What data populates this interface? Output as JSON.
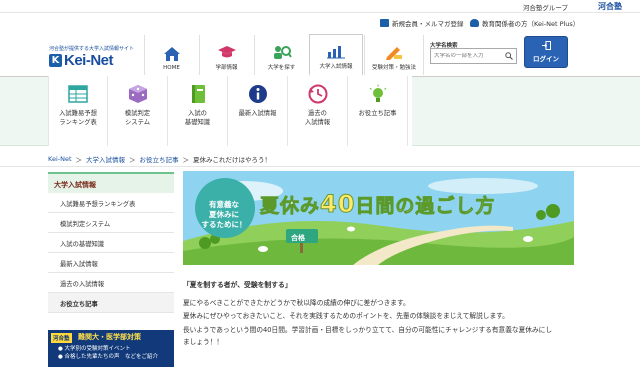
{
  "top": {
    "group_text": "河合塾グループ",
    "group_logo": "河合塾",
    "link_register": "新規会員・メルマガ登録",
    "link_teacher": "教育関係者の方（Kei-Net Plus）"
  },
  "logo": {
    "subtitle": "河合塾が提供する大学入試情報サイト",
    "mark": "K",
    "name": "Kei-Net"
  },
  "nav": {
    "tabs": [
      {
        "label": "HOME",
        "icon": "home-icon"
      },
      {
        "label": "学部情報",
        "icon": "graduation-cap-icon"
      },
      {
        "label": "大学を探す",
        "icon": "people-search-icon"
      },
      {
        "label": "大学入試情報",
        "icon": "bar-chart-icon"
      },
      {
        "label": "受験対策・勉強法",
        "icon": "pencil-icon"
      }
    ],
    "active_tab": "大学入試情報"
  },
  "search": {
    "label": "大学名検索",
    "placeholder": "大学名の一部を入力"
  },
  "login": {
    "label": "ログイン"
  },
  "subnav": {
    "items": [
      {
        "label": "入試難易予想\nランキング表",
        "icon": "table-icon"
      },
      {
        "label": "模試判定\nシステム",
        "icon": "dice-icon"
      },
      {
        "label": "入試の\n基礎知識",
        "icon": "book-icon"
      },
      {
        "label": "最新入試情報",
        "icon": "info-icon"
      },
      {
        "label": "過去の\n入試情報",
        "icon": "calendar-icon"
      },
      {
        "label": "お役立ち記事",
        "icon": "lightbulb-icon"
      }
    ]
  },
  "breadcrumb": {
    "items": [
      "Kei-Net",
      "大学入試情報",
      "お役立ち記事",
      "夏休みこれだけはやろう！"
    ],
    "separator": "＞"
  },
  "sidebar": {
    "title": "大学入試情報",
    "items": [
      "入試難易予想ランキング表",
      "模試判定システム",
      "入試の基礎知識",
      "最新入試情報",
      "過去の入試情報",
      "お役立ち記事"
    ],
    "active": "お役立ち記事"
  },
  "banner": {
    "label": "河合塾",
    "title": "難関大・医学部対策",
    "line1": "● 大学別の受験対策イベント",
    "line2": "● 合格した先輩たちの声　などをご紹介"
  },
  "hero": {
    "badge": "有意義な\n夏休みに\nするために！",
    "title_pre": "夏休み",
    "title_num": "40",
    "title_post": "日間の過ごし方",
    "sign": "合格"
  },
  "article": {
    "quote": "「夏を制する者が、受験を制する」",
    "paragraphs": [
      "夏にやるべきことができたかどうかで秋以降の成績の伸びに差がつきます。",
      "夏休みにぜひやっておきたいこと、それを実践するためのポイントを、先輩の体験談をまじえて解説します。",
      "長いようであっという間の40日間。学習計画・目標をしっかり立てて、自分の可能性にチャレンジする有意義な夏休みにし",
      "ましょう！！"
    ]
  },
  "colors": {
    "brand_blue": "#1a4fa0",
    "login_blue": "#2a63b3",
    "subnav_green": "#eef7f1",
    "sidebar_accent": "#6cc28a"
  }
}
